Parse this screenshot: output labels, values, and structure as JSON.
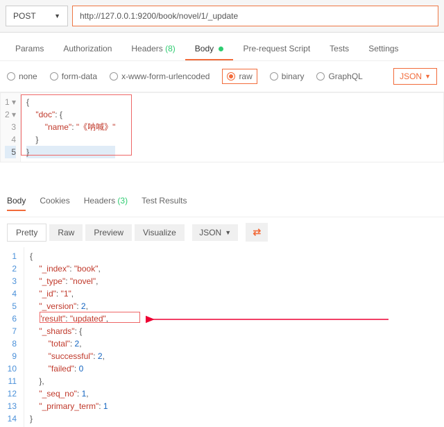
{
  "request": {
    "method": "POST",
    "url": "http://127.0.0.1:9200/book/novel/1/_update"
  },
  "tabs": {
    "params": "Params",
    "auth": "Authorization",
    "headers_label": "Headers",
    "headers_count": "(8)",
    "body": "Body",
    "prerequest": "Pre-request Script",
    "tests": "Tests",
    "settings": "Settings"
  },
  "bodytypes": {
    "none": "none",
    "formdata": "form-data",
    "xwww": "x-www-form-urlencoded",
    "raw": "raw",
    "binary": "binary",
    "graphql": "GraphQL",
    "json_dd": "JSON"
  },
  "reqjson": {
    "l1": "{",
    "l2a": "\"doc\"",
    "l2b": ": {",
    "l3a": "\"name\"",
    "l3b": ": ",
    "l3c": "\"《呐喊》\"",
    "l4": "}",
    "l5": "}"
  },
  "resptabs": {
    "body": "Body",
    "cookies": "Cookies",
    "headers_label": "Headers",
    "headers_count": "(3)",
    "tests": "Test Results"
  },
  "viewbar": {
    "pretty": "Pretty",
    "raw": "Raw",
    "preview": "Preview",
    "visualize": "Visualize",
    "json": "JSON"
  },
  "resp": {
    "l1": "{",
    "l2k": "\"_index\"",
    "l2v": "\"book\"",
    "l3k": "\"_type\"",
    "l3v": "\"novel\"",
    "l4k": "\"_id\"",
    "l4v": "\"1\"",
    "l5k": "\"_version\"",
    "l5v": "2",
    "l6k": "\"result\"",
    "l6v": "\"updated\"",
    "l7k": "\"_shards\"",
    "l8k": "\"total\"",
    "l8v": "2",
    "l9k": "\"successful\"",
    "l9v": "2",
    "l10k": "\"failed\"",
    "l10v": "0",
    "l11": "},",
    "l12k": "\"_seq_no\"",
    "l12v": "1",
    "l13k": "\"_primary_term\"",
    "l13v": "1",
    "l14": "}"
  },
  "colors": {
    "orange": "#f26b3a",
    "red_annot": "#e74c3c"
  }
}
